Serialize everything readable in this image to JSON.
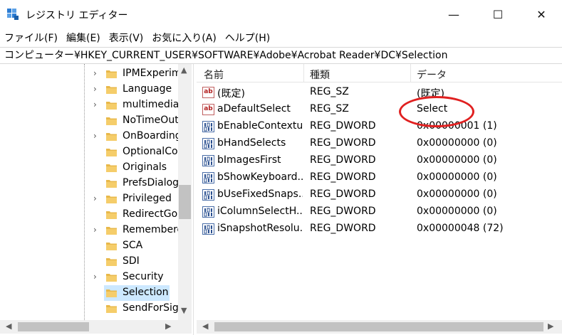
{
  "window": {
    "title": "レジストリ エディター",
    "minimize_glyph": "—",
    "maximize_glyph": "☐",
    "close_glyph": "✕"
  },
  "menu": [
    {
      "label": "ファイル(F)"
    },
    {
      "label": "編集(E)"
    },
    {
      "label": "表示(V)"
    },
    {
      "label": "お気に入り(A)"
    },
    {
      "label": "ヘルプ(H)"
    }
  ],
  "address": {
    "path": "コンピューター¥HKEY_CURRENT_USER¥SOFTWARE¥Adobe¥Acrobat Reader¥DC¥Selection"
  },
  "tree": {
    "items": [
      {
        "label": "IPMExperim",
        "has_children": true,
        "selected": false
      },
      {
        "label": "Language",
        "has_children": true,
        "selected": false
      },
      {
        "label": "multimedia",
        "has_children": true,
        "selected": false
      },
      {
        "label": "NoTimeOut",
        "has_children": false,
        "selected": false
      },
      {
        "label": "OnBoarding",
        "has_children": true,
        "selected": false
      },
      {
        "label": "OptionalCo",
        "has_children": false,
        "selected": false
      },
      {
        "label": "Originals",
        "has_children": false,
        "selected": false
      },
      {
        "label": "PrefsDialog",
        "has_children": false,
        "selected": false
      },
      {
        "label": "Privileged",
        "has_children": true,
        "selected": false
      },
      {
        "label": "RedirectGoI",
        "has_children": false,
        "selected": false
      },
      {
        "label": "Remembere",
        "has_children": true,
        "selected": false
      },
      {
        "label": "SCA",
        "has_children": false,
        "selected": false
      },
      {
        "label": "SDI",
        "has_children": false,
        "selected": false
      },
      {
        "label": "Security",
        "has_children": true,
        "selected": false
      },
      {
        "label": "Selection",
        "has_children": false,
        "selected": true
      },
      {
        "label": "SendForSigi",
        "has_children": false,
        "selected": false
      }
    ],
    "arrow_up": "▲",
    "arrow_down": "▼",
    "arrow_left": "◀",
    "arrow_right": "▶"
  },
  "values": {
    "headers": {
      "name": "名前",
      "type": "種類",
      "data": "データ"
    },
    "rows": [
      {
        "icon": "string-value-icon",
        "name": "(既定)",
        "type": "REG_SZ",
        "data": "(既定)"
      },
      {
        "icon": "string-value-icon",
        "name": "aDefaultSelect",
        "type": "REG_SZ",
        "data": "Select"
      },
      {
        "icon": "binary-value-icon",
        "name": "bEnableContextu",
        "type": "REG_DWORD",
        "data": "0x00000001 (1)"
      },
      {
        "icon": "binary-value-icon",
        "name": "bHandSelects",
        "type": "REG_DWORD",
        "data": "0x00000000 (0)"
      },
      {
        "icon": "binary-value-icon",
        "name": "bImagesFirst",
        "type": "REG_DWORD",
        "data": "0x00000000 (0)"
      },
      {
        "icon": "binary-value-icon",
        "name": "bShowKeyboard...",
        "type": "REG_DWORD",
        "data": "0x00000000 (0)"
      },
      {
        "icon": "binary-value-icon",
        "name": "bUseFixedSnaps...",
        "type": "REG_DWORD",
        "data": "0x00000000 (0)"
      },
      {
        "icon": "binary-value-icon",
        "name": "iColumnSelectH...",
        "type": "REG_DWORD",
        "data": "0x00000000 (0)"
      },
      {
        "icon": "binary-value-icon",
        "name": "iSnapshotResolu...",
        "type": "REG_DWORD",
        "data": "0x00000048 (72)"
      }
    ],
    "string_icon_text": "ab",
    "arrow_left": "◀",
    "arrow_right": "▶"
  },
  "colors": {
    "selection": "#cce8ff",
    "annotation_circle": "#e02020",
    "folder": "#e8b84a"
  }
}
